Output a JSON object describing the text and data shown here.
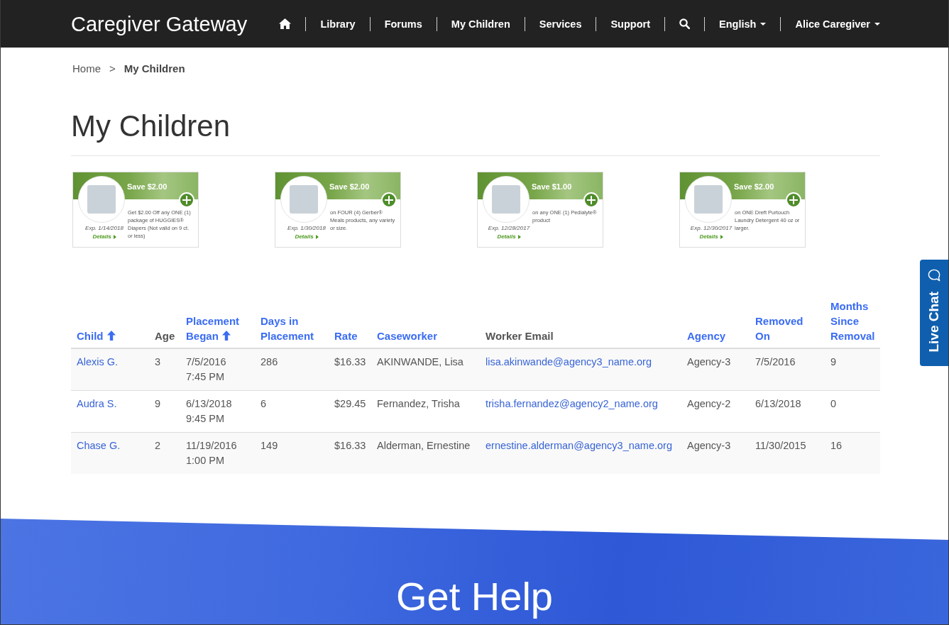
{
  "nav": {
    "brand": "Caregiver Gateway",
    "items": [
      {
        "kind": "home"
      },
      {
        "kind": "link",
        "label": "Library"
      },
      {
        "kind": "link",
        "label": "Forums"
      },
      {
        "kind": "link",
        "label": "My Children"
      },
      {
        "kind": "link",
        "label": "Services"
      },
      {
        "kind": "link",
        "label": "Support"
      },
      {
        "kind": "search"
      },
      {
        "kind": "dropdown",
        "label": "English"
      },
      {
        "kind": "dropdown",
        "label": "Alice Caregiver"
      }
    ]
  },
  "breadcrumb": {
    "separator": ">",
    "items": [
      {
        "label": "Home",
        "current": false
      },
      {
        "label": "My Children",
        "current": true
      }
    ]
  },
  "page_title": "My Children",
  "coupons": [
    {
      "amount": "Save $2.00",
      "description": "Get $2.00 Off any ONE (1) package of HUGGIES® Diapers (Not valid on 9 ct. or less)",
      "expires": "Exp. 1/14/2018",
      "details": "Details"
    },
    {
      "amount": "Save $2.00",
      "description": "on FOUR (4) Gerber® Meals products, any variety or size.",
      "expires": "Exp. 1/30/2018",
      "details": "Details"
    },
    {
      "amount": "Save $1.00",
      "description": "on any ONE (1) Pedialyte® product",
      "expires": "Exp. 12/28/2017",
      "details": "Details"
    },
    {
      "amount": "Save $2.00",
      "description": "on ONE Dreft Purtouch Laundry Detergent 40 oz or larger.",
      "expires": "Exp. 12/30/2017",
      "details": "Details"
    }
  ],
  "table": {
    "columns": [
      {
        "label": "Child",
        "sortable": true,
        "sorted": true,
        "links": true
      },
      {
        "label": "Age",
        "sortable": false,
        "sorted": false,
        "links": false
      },
      {
        "label": "Placement Began",
        "sortable": true,
        "sorted": true,
        "links": false
      },
      {
        "label": "Days in Placement",
        "sortable": true,
        "sorted": false,
        "links": false
      },
      {
        "label": "Rate",
        "sortable": true,
        "sorted": false,
        "links": false
      },
      {
        "label": "Caseworker",
        "sortable": true,
        "sorted": false,
        "links": false
      },
      {
        "label": "Worker Email",
        "sortable": false,
        "sorted": false,
        "links": true
      },
      {
        "label": "Agency",
        "sortable": true,
        "sorted": false,
        "links": false
      },
      {
        "label": "Removed On",
        "sortable": true,
        "sorted": false,
        "links": false
      },
      {
        "label": "Months Since Removal",
        "sortable": true,
        "sorted": false,
        "links": false
      }
    ],
    "rows": [
      {
        "cells": [
          "Alexis G.",
          "3",
          "7/5/2016 7:45 PM",
          "286",
          "$16.33",
          "AKINWANDE, Lisa",
          "lisa.akinwande@agency3_name.org",
          "Agency-3",
          "7/5/2016",
          "9"
        ]
      },
      {
        "cells": [
          "Audra S.",
          "9",
          "6/13/2018 9:45 PM",
          "6",
          "$29.45",
          "Fernandez, Trisha",
          "trisha.fernandez@agency2_name.org",
          "Agency-2",
          "6/13/2018",
          "0"
        ]
      },
      {
        "cells": [
          "Chase G.",
          "2",
          "11/19/2016 1:00 PM",
          "149",
          "$16.33",
          "Alderman, Ernestine",
          "ernestine.alderman@agency3_name.org",
          "Agency-3",
          "11/30/2015",
          "16"
        ]
      }
    ]
  },
  "live_chat": {
    "label": "Live Chat"
  },
  "banner": {
    "heading": "Get Help"
  }
}
